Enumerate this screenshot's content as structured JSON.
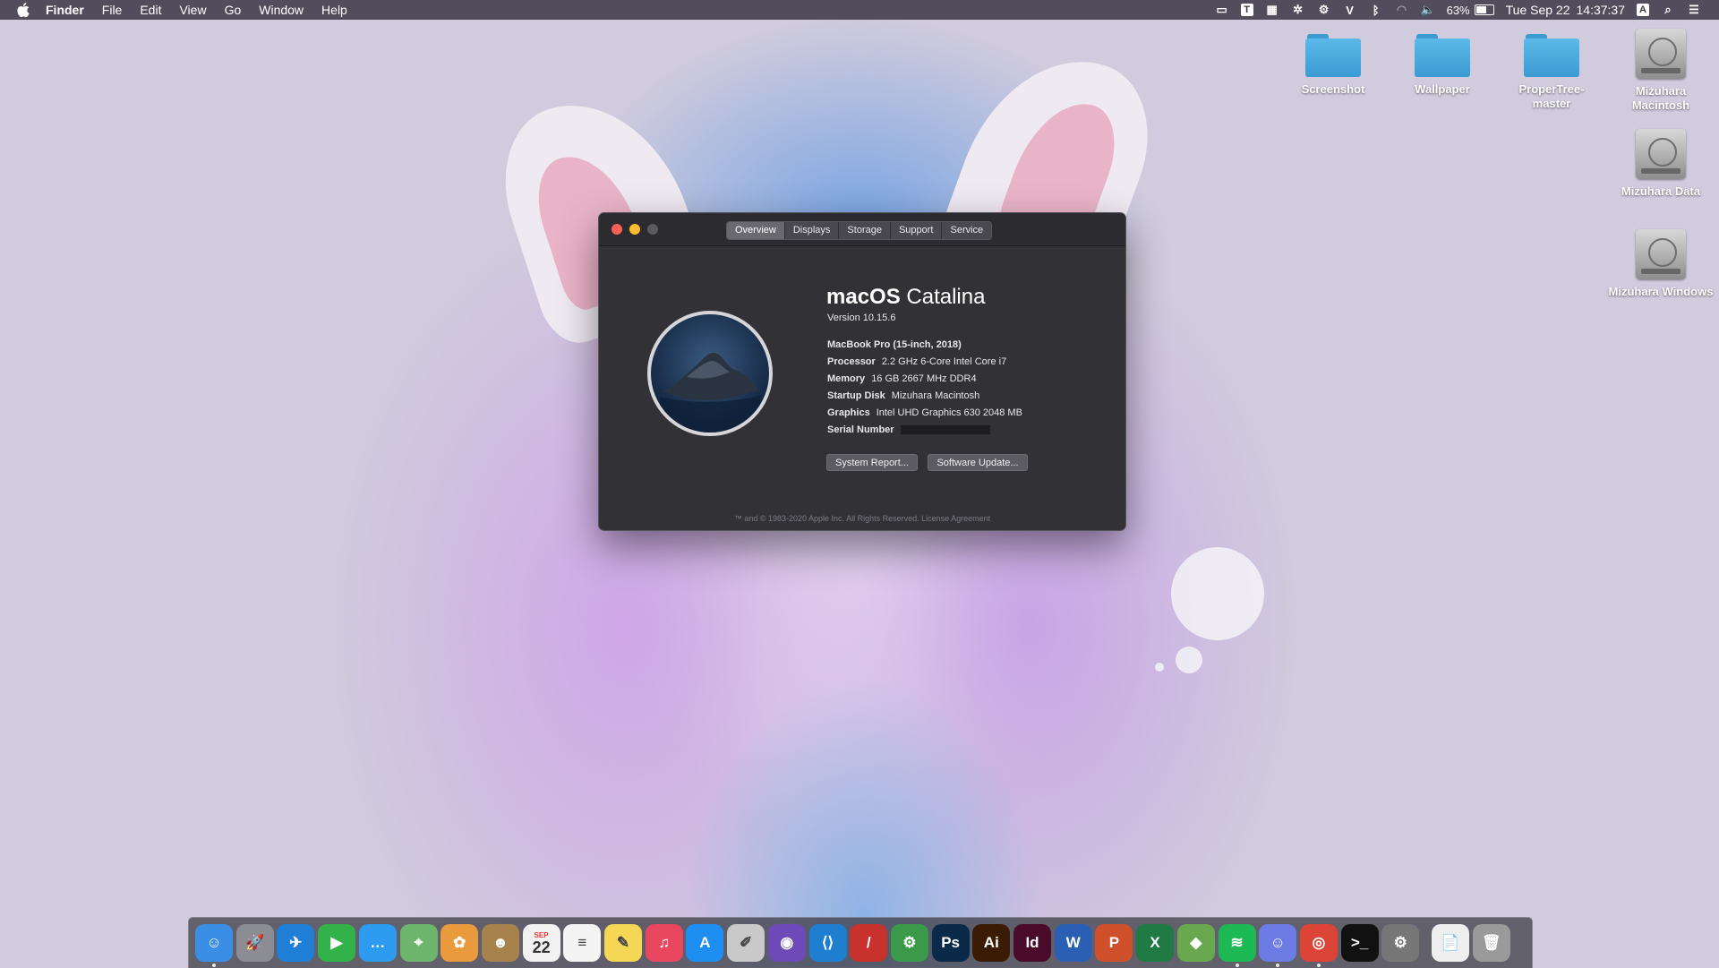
{
  "menubar": {
    "app_name": "Finder",
    "items": [
      "File",
      "Edit",
      "View",
      "Go",
      "Window",
      "Help"
    ],
    "status_icons": [
      "notification-icon",
      "t-icon",
      "grid-icon",
      "asterisk-icon",
      "gear-icon",
      "v-icon",
      "bluetooth-icon",
      "wifi-icon",
      "volume-icon"
    ],
    "t_glyph": "T",
    "v_glyph": "V",
    "battery_percent": "63%",
    "date": "Tue Sep 22",
    "time": "14:37:37",
    "input_glyph": "A"
  },
  "desktop": {
    "icons": [
      {
        "label": "Screenshot",
        "type": "folder"
      },
      {
        "label": "Wallpaper",
        "type": "folder"
      },
      {
        "label": "ProperTree-master",
        "type": "folder"
      },
      {
        "label": "Mizuhara Macintosh",
        "type": "drive"
      },
      {
        "label": "Mizuhara Data",
        "type": "drive"
      },
      {
        "label": "Mizuhara Windows",
        "type": "drive"
      }
    ]
  },
  "about_window": {
    "tabs": [
      "Overview",
      "Displays",
      "Storage",
      "Support",
      "Service"
    ],
    "active_tab": "Overview",
    "os_name_bold": "macOS",
    "os_name_light": "Catalina",
    "version": "Version 10.15.6",
    "model": "MacBook Pro (15-inch, 2018)",
    "specs": [
      {
        "key": "Processor",
        "value": "2.2 GHz 6-Core Intel Core i7"
      },
      {
        "key": "Memory",
        "value": "16 GB 2667 MHz DDR4"
      },
      {
        "key": "Startup Disk",
        "value": "Mizuhara Macintosh"
      },
      {
        "key": "Graphics",
        "value": "Intel UHD Graphics 630 2048 MB"
      }
    ],
    "serial_label": "Serial Number",
    "system_report_button": "System Report...",
    "software_update_button": "Software Update...",
    "footer": "™ and © 1983-2020 Apple Inc. All Rights Reserved. License Agreement"
  },
  "dock": {
    "calendar_month": "SEP",
    "calendar_day": "22",
    "items": [
      {
        "name": "finder",
        "glyph": "☺",
        "color": "#3a8ee6",
        "running": true
      },
      {
        "name": "launchpad",
        "glyph": "🚀",
        "color": "#8c8c94",
        "running": false
      },
      {
        "name": "safari",
        "glyph": "✈",
        "color": "#1f7fd6",
        "running": false
      },
      {
        "name": "facetime",
        "glyph": "▶",
        "color": "#34b24a",
        "running": false
      },
      {
        "name": "messages",
        "glyph": "…",
        "color": "#2c9bf0",
        "running": false
      },
      {
        "name": "maps",
        "glyph": "⌖",
        "color": "#6db56d",
        "running": false
      },
      {
        "name": "photos",
        "glyph": "✿",
        "color": "#e89a3c",
        "running": false
      },
      {
        "name": "contacts",
        "glyph": "☻",
        "color": "#a8824d",
        "running": false
      },
      {
        "name": "calendar",
        "glyph": "22",
        "color": "#f2f2f2",
        "running": false
      },
      {
        "name": "reminders",
        "glyph": "≡",
        "color": "#f4f4f4",
        "running": false
      },
      {
        "name": "notes",
        "glyph": "✎",
        "color": "#f5d655",
        "running": false
      },
      {
        "name": "music",
        "glyph": "♫",
        "color": "#e8475f",
        "running": false
      },
      {
        "name": "app-store",
        "glyph": "A",
        "color": "#1d8ff2",
        "running": false
      },
      {
        "name": "script-editor",
        "glyph": "✐",
        "color": "#c9c9c9",
        "running": false
      },
      {
        "name": "github-desktop",
        "glyph": "◉",
        "color": "#6e4ab8",
        "running": false
      },
      {
        "name": "vscode",
        "glyph": "⟨⟩",
        "color": "#1e7fd1",
        "running": false
      },
      {
        "name": "pen-app",
        "glyph": "/",
        "color": "#c8312c",
        "running": false
      },
      {
        "name": "gear-app",
        "glyph": "⚙",
        "color": "#3a9a4a",
        "running": false
      },
      {
        "name": "photoshop",
        "glyph": "Ps",
        "color": "#0b2a4a",
        "running": false
      },
      {
        "name": "illustrator",
        "glyph": "Ai",
        "color": "#3a1c05",
        "running": false
      },
      {
        "name": "indesign",
        "glyph": "Id",
        "color": "#4a0a2c",
        "running": false
      },
      {
        "name": "word",
        "glyph": "W",
        "color": "#2b5fb4",
        "running": false
      },
      {
        "name": "powerpoint",
        "glyph": "P",
        "color": "#d1502c",
        "running": false
      },
      {
        "name": "excel",
        "glyph": "X",
        "color": "#1f7a44",
        "running": false
      },
      {
        "name": "bluestacks",
        "glyph": "◆",
        "color": "#6aa84f",
        "running": false
      },
      {
        "name": "spotify",
        "glyph": "≋",
        "color": "#1db954",
        "running": true
      },
      {
        "name": "discord",
        "glyph": "☺",
        "color": "#6d7ce4",
        "running": true
      },
      {
        "name": "chrome",
        "glyph": "◎",
        "color": "#db4437",
        "running": true
      },
      {
        "name": "terminal",
        "glyph": ">_",
        "color": "#111111",
        "running": false
      },
      {
        "name": "system-preferences",
        "glyph": "⚙",
        "color": "#777777",
        "running": false
      },
      {
        "name": "text-document",
        "glyph": "📄",
        "color": "#eeeeee",
        "running": false
      },
      {
        "name": "trash",
        "glyph": "🗑",
        "color": "#9a9a9a",
        "running": false
      }
    ]
  }
}
